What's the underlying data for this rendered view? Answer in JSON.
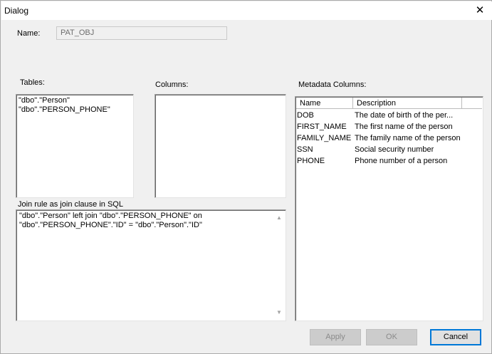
{
  "dialog": {
    "title": "Dialog"
  },
  "name": {
    "label": "Name:",
    "value": "PAT_OBJ"
  },
  "tables": {
    "label": "Tables:",
    "items": [
      "\"dbo\".\"Person\"",
      "\"dbo\".\"PERSON_PHONE\""
    ]
  },
  "columns": {
    "label": "Columns:"
  },
  "join": {
    "label": "Join rule as join clause in SQL",
    "text": "\"dbo\".\"Person\" left join \"dbo\".\"PERSON_PHONE\" on\n\"dbo\".\"PERSON_PHONE\".\"ID\" = \"dbo\".\"Person\".\"ID\""
  },
  "metadata": {
    "label": "Metadata Columns:",
    "headers": [
      "Name",
      "Description"
    ],
    "rows": [
      {
        "name": "DOB",
        "description": "The date of birth of the per..."
      },
      {
        "name": "FIRST_NAME",
        "description": "The first name of the person"
      },
      {
        "name": "FAMILY_NAME",
        "description": "The family name of the person"
      },
      {
        "name": "SSN",
        "description": "Social security number"
      },
      {
        "name": "PHONE",
        "description": "Phone number of a person"
      }
    ]
  },
  "buttons": {
    "apply": "Apply",
    "ok": "OK",
    "cancel": "Cancel"
  },
  "icons": {
    "close": "close-icon",
    "scroll_up": "scroll-up-arrow-icon",
    "scroll_down": "scroll-down-arrow-icon"
  }
}
